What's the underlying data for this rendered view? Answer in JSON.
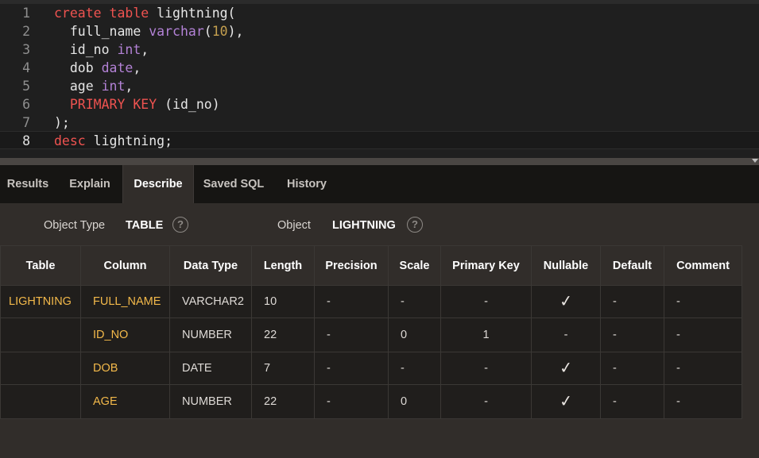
{
  "editor": {
    "lines": [
      {
        "n": "1",
        "tokens": [
          [
            "kw",
            "create"
          ],
          [
            "id",
            " "
          ],
          [
            "kw",
            "table"
          ],
          [
            "id",
            " lightning("
          ]
        ]
      },
      {
        "n": "2",
        "tokens": [
          [
            "id",
            "  full_name "
          ],
          [
            "ty",
            "varchar"
          ],
          [
            "id",
            "("
          ],
          [
            "num",
            "10"
          ],
          [
            "id",
            "),"
          ]
        ]
      },
      {
        "n": "3",
        "tokens": [
          [
            "id",
            "  id_no "
          ],
          [
            "ty",
            "int"
          ],
          [
            "id",
            ","
          ]
        ]
      },
      {
        "n": "4",
        "tokens": [
          [
            "id",
            "  dob "
          ],
          [
            "ty",
            "date"
          ],
          [
            "id",
            ","
          ]
        ]
      },
      {
        "n": "5",
        "tokens": [
          [
            "id",
            "  age "
          ],
          [
            "ty",
            "int"
          ],
          [
            "id",
            ","
          ]
        ]
      },
      {
        "n": "6",
        "tokens": [
          [
            "id",
            "  "
          ],
          [
            "kw",
            "PRIMARY KEY"
          ],
          [
            "id",
            " (id_no)"
          ]
        ]
      },
      {
        "n": "7",
        "tokens": [
          [
            "id",
            ");"
          ]
        ]
      },
      {
        "n": "8",
        "tokens": [
          [
            "kw",
            "desc"
          ],
          [
            "id",
            " lightning;"
          ]
        ],
        "current": true
      }
    ]
  },
  "tabs": [
    {
      "label": "Results",
      "active": false
    },
    {
      "label": "Explain",
      "active": false
    },
    {
      "label": "Describe",
      "active": true
    },
    {
      "label": "Saved SQL",
      "active": false
    },
    {
      "label": "History",
      "active": false
    }
  ],
  "info": {
    "object_type_label": "Object Type",
    "object_type_value": "TABLE",
    "object_label": "Object",
    "object_value": "LIGHTNING",
    "help_glyph": "?"
  },
  "table": {
    "headers": [
      "Table",
      "Column",
      "Data Type",
      "Length",
      "Precision",
      "Scale",
      "Primary Key",
      "Nullable",
      "Default",
      "Comment"
    ],
    "rows": [
      [
        "LIGHTNING",
        "FULL_NAME",
        "VARCHAR2",
        "10",
        "-",
        "-",
        "-",
        "✓",
        "-",
        "-"
      ],
      [
        "",
        "ID_NO",
        "NUMBER",
        "22",
        "-",
        "0",
        "1",
        "-",
        "-",
        "-"
      ],
      [
        "",
        "DOB",
        "DATE",
        "7",
        "-",
        "-",
        "-",
        "✓",
        "-",
        "-"
      ],
      [
        "",
        "AGE",
        "NUMBER",
        "22",
        "-",
        "0",
        "-",
        "✓",
        "-",
        "-"
      ]
    ]
  },
  "colors": {
    "keyword": "#ef5350",
    "type": "#b382d6",
    "number": "#c5a04f",
    "highlight_value": "#f3b94a"
  }
}
